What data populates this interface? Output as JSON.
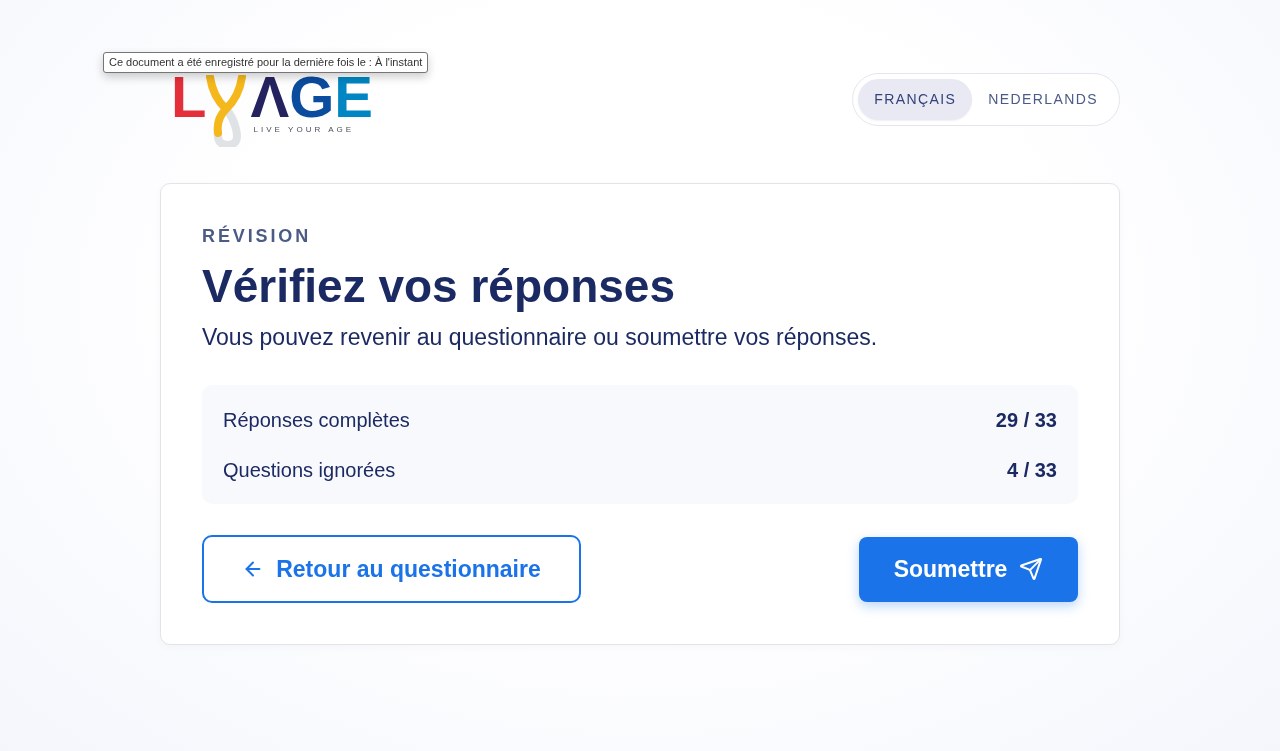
{
  "tooltip": "Ce document a été enregistré pour la dernière fois le : À l'instant",
  "logo": {
    "letters": [
      {
        "char": "L",
        "color": "#e42f3a"
      },
      {
        "char": "Λ",
        "color": "#25235f"
      },
      {
        "char": "G",
        "color": "#0b4c9e"
      },
      {
        "char": "E",
        "color": "#0086c3"
      }
    ],
    "tagline": "LIVE YOUR AGE"
  },
  "language_switch": [
    {
      "label": "FRANÇAIS",
      "selected": true
    },
    {
      "label": "NEDERLANDS",
      "selected": false
    }
  ],
  "review": {
    "eyebrow": "RÉVISION",
    "title": "Vérifiez vos réponses",
    "subtitle": "Vous pouvez revenir au questionnaire ou soumettre vos réponses.",
    "summary": [
      {
        "label": "Réponses complètes",
        "value": "29 / 33"
      },
      {
        "label": "Questions ignorées",
        "value": "4 / 33"
      }
    ],
    "back_button": "Retour au questionnaire",
    "submit_button": "Soumettre"
  }
}
